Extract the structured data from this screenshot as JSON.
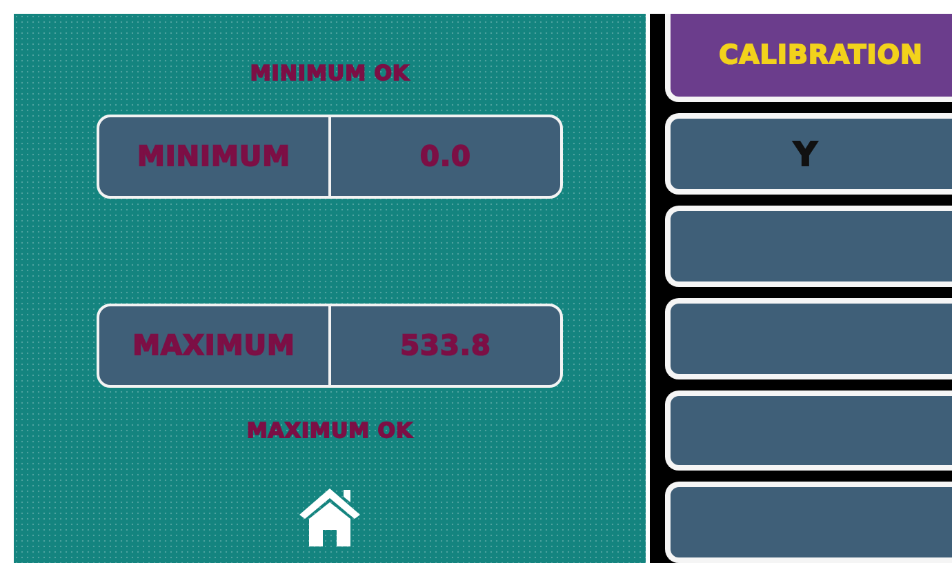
{
  "status_top": "MINIMUM OK",
  "readings": [
    {
      "label": "MINIMUM",
      "value": "0.0"
    },
    {
      "label": "MAXIMUM",
      "value": "533.8"
    }
  ],
  "status_bottom": "MAXIMUM OK",
  "menu": [
    {
      "kind": "header",
      "label": "CALIBRATION"
    },
    {
      "kind": "item",
      "label": "Y"
    },
    {
      "kind": "item"
    },
    {
      "kind": "item"
    },
    {
      "kind": "item"
    },
    {
      "kind": "item"
    }
  ]
}
